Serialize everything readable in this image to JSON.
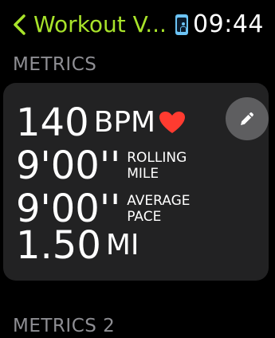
{
  "status_bar": {
    "back_label": "Workout V...",
    "time": "09:44"
  },
  "sections": {
    "metrics_title": "METRICS",
    "metrics2_title": "METRICS 2"
  },
  "metrics": {
    "heart_rate": {
      "value": "140",
      "unit": "BPM"
    },
    "rolling_mile": {
      "value": "9'00''",
      "unit_line1": "ROLLING",
      "unit_line2": "MILE"
    },
    "average_pace": {
      "value": "9'00''",
      "unit_line1": "AVERAGE",
      "unit_line2": "PACE"
    },
    "distance": {
      "value": "1.50",
      "unit": "MI"
    }
  },
  "icons": {
    "back": "chevron-left-icon",
    "workout": "workout-app-icon",
    "heart": "heart-icon",
    "edit": "pencil-icon"
  },
  "colors": {
    "accent": "#a8e32a",
    "heart": "#ff3b30",
    "card": "#222223",
    "header_gray": "#8e8e93",
    "edit_button": "#5e5e60"
  }
}
